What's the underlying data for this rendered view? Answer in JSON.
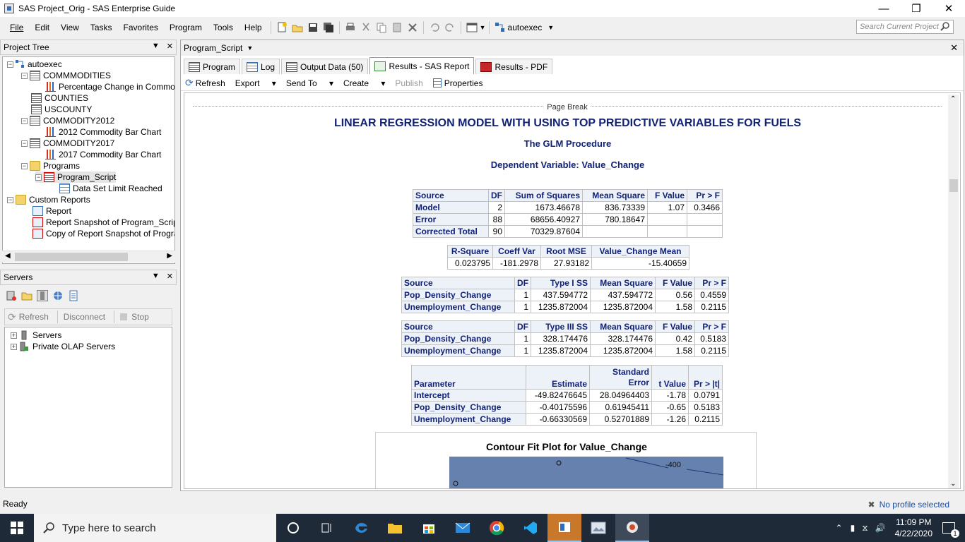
{
  "window": {
    "title": "SAS Project_Orig - SAS Enterprise Guide"
  },
  "menu": [
    "File",
    "Edit",
    "View",
    "Tasks",
    "Favorites",
    "Program",
    "Tools",
    "Help"
  ],
  "toolbar": {
    "autoexec_label": "autoexec",
    "search_placeholder": "Search Current Project"
  },
  "project_tree": {
    "title": "Project Tree",
    "items": [
      "autoexec",
      "COMMMODITIES",
      "Percentage Change in Commodity",
      "COUNTIES",
      "USCOUNTY",
      "COMMODITY2012",
      "2012 Commodity Bar Chart",
      "COMMODITY2017",
      "2017 Commodity Bar Chart",
      "Programs",
      "Program_Script",
      "Data Set Limit Reached",
      "Custom Reports",
      "Report",
      "Report Snapshot of Program_Script",
      "Copy of Report Snapshot of Program_"
    ]
  },
  "servers": {
    "title": "Servers",
    "buttons": {
      "refresh": "Refresh",
      "disconnect": "Disconnect",
      "stop": "Stop"
    },
    "items": [
      "Servers",
      "Private OLAP Servers"
    ]
  },
  "document": {
    "header": "Program_Script",
    "tabs": [
      "Program",
      "Log",
      "Output Data (50)",
      "Results - SAS Report",
      "Results - PDF"
    ],
    "subtoolbar": [
      "Refresh",
      "Export",
      "Send To",
      "Create",
      "Publish",
      "Properties"
    ]
  },
  "report": {
    "page_break": "Page Break",
    "title": "LINEAR REGRESSION MODEL WITH USING TOP PREDICTIVE VARIABLES FOR FUELS",
    "procedure": "The GLM Procedure",
    "dependent": "Dependent Variable: Value_Change",
    "anova": {
      "headers": [
        "Source",
        "DF",
        "Sum of Squares",
        "Mean Square",
        "F Value",
        "Pr > F"
      ],
      "rows": [
        [
          "Model",
          "2",
          "1673.46678",
          "836.73339",
          "1.07",
          "0.3466"
        ],
        [
          "Error",
          "88",
          "68656.40927",
          "780.18647",
          "",
          ""
        ],
        [
          "Corrected Total",
          "90",
          "70329.87604",
          "",
          "",
          ""
        ]
      ]
    },
    "fit": {
      "headers": [
        "R-Square",
        "Coeff Var",
        "Root MSE",
        "Value_Change Mean"
      ],
      "values": [
        "0.023795",
        "-181.2978",
        "27.93182",
        "-15.40659"
      ]
    },
    "type1": {
      "headers": [
        "Source",
        "DF",
        "Type I SS",
        "Mean Square",
        "F Value",
        "Pr > F"
      ],
      "rows": [
        [
          "Pop_Density_Change",
          "1",
          "437.594772",
          "437.594772",
          "0.56",
          "0.4559"
        ],
        [
          "Unemployment_Change",
          "1",
          "1235.872004",
          "1235.872004",
          "1.58",
          "0.2115"
        ]
      ]
    },
    "type3": {
      "headers": [
        "Source",
        "DF",
        "Type III SS",
        "Mean Square",
        "F Value",
        "Pr > F"
      ],
      "rows": [
        [
          "Pop_Density_Change",
          "1",
          "328.174476",
          "328.174476",
          "0.42",
          "0.5183"
        ],
        [
          "Unemployment_Change",
          "1",
          "1235.872004",
          "1235.872004",
          "1.58",
          "0.2115"
        ]
      ]
    },
    "params": {
      "headers": [
        "Parameter",
        "Estimate",
        "Standard Error",
        "t Value",
        "Pr > |t|"
      ],
      "std_top": "Standard",
      "std_bottom": "Error",
      "rows": [
        [
          "Intercept",
          "-49.82476645",
          "28.04964403",
          "-1.78",
          "0.0791"
        ],
        [
          "Pop_Density_Change",
          "-0.40175596",
          "0.61945411",
          "-0.65",
          "0.5183"
        ],
        [
          "Unemployment_Change",
          "-0.66330569",
          "0.52701889",
          "-1.26",
          "0.2115"
        ]
      ]
    },
    "contour": {
      "title": "Contour Fit Plot for Value_Change",
      "label": "-400"
    }
  },
  "status": {
    "text": "Ready",
    "profile": "No profile selected"
  },
  "taskbar": {
    "search": "Type here to search",
    "time": "11:09 PM",
    "date": "4/22/2020",
    "notifications": "1"
  }
}
